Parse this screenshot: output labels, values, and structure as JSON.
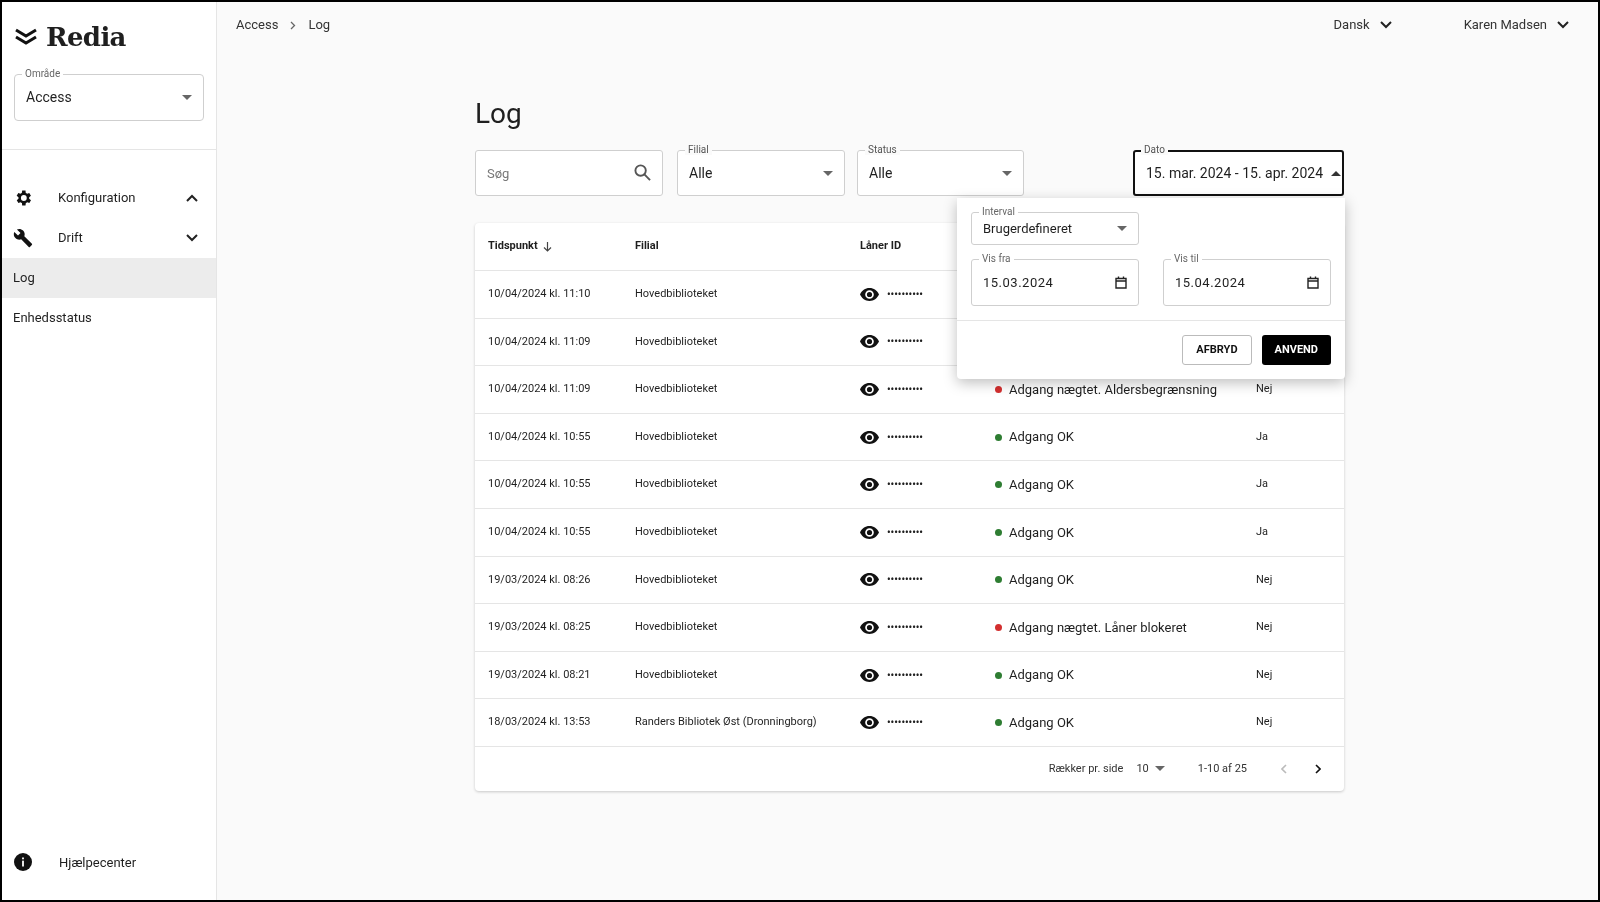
{
  "sidebar": {
    "logo": "Redia",
    "area_select": {
      "label": "Område",
      "value": "Access"
    },
    "nav": [
      {
        "kind": "group",
        "label": "Konfiguration",
        "expanded": true,
        "selected": false
      },
      {
        "kind": "group",
        "label": "Drift",
        "expanded": false,
        "selected": false
      },
      {
        "kind": "item",
        "label": "Log",
        "selected": true
      },
      {
        "kind": "item",
        "label": "Enhedsstatus",
        "selected": false
      }
    ],
    "help": {
      "label": "Hjælpecenter"
    }
  },
  "breadcrumb": [
    "Access",
    "Log"
  ],
  "header": {
    "language": "Dansk",
    "user": "Karen Madsen"
  },
  "page_title": "Log",
  "filters": {
    "search": {
      "placeholder": "Søg"
    },
    "branch": {
      "label": "Filial",
      "value": "Alle"
    },
    "status": {
      "label": "Status",
      "value": "Alle"
    },
    "date": {
      "label": "Dato",
      "value": "15. mar. 2024 - 15. apr. 2024",
      "expanded": true
    }
  },
  "date_popup": {
    "interval": {
      "label": "Interval",
      "value": "Brugerdefineret"
    },
    "from": {
      "label": "Vis fra",
      "value": "15.03.2024"
    },
    "to": {
      "label": "Vis til",
      "value": "15.04.2024"
    },
    "buttons": [
      {
        "kind": "outline",
        "label": "AFBRYD"
      },
      {
        "kind": "primary",
        "label": "ANVEND"
      }
    ]
  },
  "table": {
    "columns": [
      "Tidspunkt",
      "Filial",
      "Låner ID"
    ],
    "rows": [
      {
        "time": "10/04/2024 kl. 11:10",
        "branch": "Hovedbiblioteket",
        "borrower_id": "••••••••••"
      },
      {
        "time": "10/04/2024 kl. 11:09",
        "branch": "Hovedbiblioteket",
        "borrower_id": "••••••••••"
      },
      {
        "time": "10/04/2024 kl. 11:09",
        "branch": "Hovedbiblioteket",
        "borrower_id": "••••••••••",
        "status": "Adgang nægtet. Aldersbegrænsning",
        "color": "#d32f2f",
        "column_5": "Nej"
      },
      {
        "time": "10/04/2024 kl. 10:55",
        "branch": "Hovedbiblioteket",
        "borrower_id": "••••••••••",
        "status": "Adgang OK",
        "color": "#2e7d32",
        "column_5": "Ja"
      },
      {
        "time": "10/04/2024 kl. 10:55",
        "branch": "Hovedbiblioteket",
        "borrower_id": "••••••••••",
        "status": "Adgang OK",
        "color": "#2e7d32",
        "column_5": "Ja"
      },
      {
        "time": "10/04/2024 kl. 10:55",
        "branch": "Hovedbiblioteket",
        "borrower_id": "••••••••••",
        "status": "Adgang OK",
        "color": "#2e7d32",
        "column_5": "Ja"
      },
      {
        "time": "19/03/2024 kl. 08:26",
        "branch": "Hovedbiblioteket",
        "borrower_id": "••••••••••",
        "status": "Adgang OK",
        "color": "#2e7d32",
        "column_5": "Nej"
      },
      {
        "time": "19/03/2024 kl. 08:25",
        "branch": "Hovedbiblioteket",
        "borrower_id": "••••••••••",
        "status": "Adgang nægtet. Låner blokeret",
        "color": "#d32f2f",
        "column_5": "Nej"
      },
      {
        "time": "19/03/2024 kl. 08:21",
        "branch": "Hovedbiblioteket",
        "borrower_id": "••••••••••",
        "status": "Adgang OK",
        "color": "#2e7d32",
        "column_5": "Nej"
      },
      {
        "time": "18/03/2024 kl. 13:53",
        "branch": "Randers Bibliotek Øst (Dronningborg)",
        "borrower_id": "••••••••••",
        "status": "Adgang OK",
        "color": "#2e7d32",
        "column_5": "Nej"
      }
    ],
    "pagination": {
      "rows_label": "Rækker pr. side",
      "rows_per_page": "10",
      "range": "1-10 af 25",
      "prev_disabled": true,
      "next_disabled": false
    }
  }
}
